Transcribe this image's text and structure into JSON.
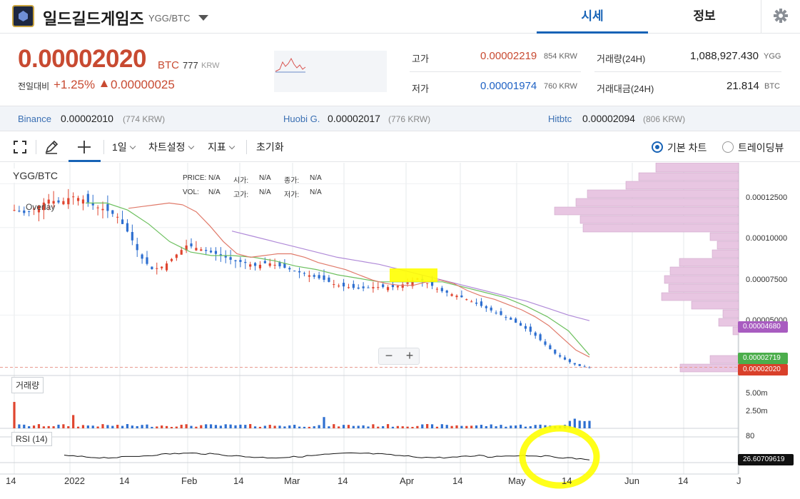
{
  "header": {
    "coin_name": "일드길드게임즈",
    "pair": "YGG/BTC",
    "tab_active": "시세",
    "tab_info": "정보"
  },
  "price": {
    "current": "0.00002020",
    "unit": "BTC",
    "krw": "777",
    "krw_unit": "KRW",
    "change_label": "전일대비",
    "change_pct": "+1.25%",
    "change_val": "0.00000025"
  },
  "stats": {
    "high_label": "고가",
    "high": "0.00002219",
    "high_krw": "854 KRW",
    "low_label": "저가",
    "low": "0.00001974",
    "low_krw": "760 KRW",
    "vol_label": "거래량(24H)",
    "vol": "1,088,927.430",
    "vol_unit": "YGG",
    "amt_label": "거래대금(24H)",
    "amt": "21.814",
    "amt_unit": "BTC"
  },
  "exchanges": [
    {
      "name": "Binance",
      "price": "0.00002010",
      "krw": "(774 KRW)"
    },
    {
      "name": "Huobi G.",
      "price": "0.00002017",
      "krw": "(776 KRW)"
    },
    {
      "name": "Hitbtc",
      "price": "0.00002094",
      "krw": "(806 KRW)"
    }
  ],
  "toolbar": {
    "fullscreen_icon": "fullscreen-icon",
    "draw_icon": "pencil-icon",
    "crosshair_icon": "plus-icon",
    "interval": "1일",
    "chart_settings": "차트설정",
    "indicators": "지표",
    "reset": "초기화",
    "basic_chart": "기본 차트",
    "trading_view": "트레이딩뷰"
  },
  "chart_data": {
    "type": "candlestick",
    "symbol": "YGG/BTC",
    "overlay_label": "Overlay",
    "info": {
      "price_label": "PRICE:",
      "price": "N/A",
      "open_label": "시가:",
      "open": "N/A",
      "close_label": "종가:",
      "close": "N/A",
      "vol_label": "VOL:",
      "vol": "N/A",
      "high_label": "고가:",
      "high": "N/A",
      "low_label": "저가:",
      "low": "N/A"
    },
    "x_ticks": [
      "14",
      "2022",
      "14",
      "Feb",
      "14",
      "Mar",
      "14",
      "Apr",
      "14",
      "May",
      "14",
      "Jun",
      "14",
      "J"
    ],
    "y_ticks": [
      "0.00012500",
      "0.00010000",
      "0.00007500",
      "0.00005000"
    ],
    "ylim": [
      1.55e-05,
      0.000137
    ],
    "close_approx": [
      0.00011,
      0.000108,
      0.000112,
      0.000116,
      0.000114,
      0.000118,
      0.000116,
      0.000112,
      0.00011,
      0.000106,
      9.6e-05,
      8.3e-05,
      7.6e-05,
      7.8e-05,
      8.4e-05,
      9e-05,
      8.8e-05,
      8.6e-05,
      8.4e-05,
      8.1e-05,
      8e-05,
      7.8e-05,
      8e-05,
      7.8e-05,
      7.6e-05,
      7.4e-05,
      7.2e-05,
      7e-05,
      6.7e-05,
      6.6e-05,
      6.5e-05,
      6.6e-05,
      6.6e-05,
      6.6e-05,
      6.8e-05,
      7.1e-05,
      6.8e-05,
      6.4e-05,
      6.2e-05,
      6e-05,
      5.7e-05,
      5.4e-05,
      5.1e-05,
      4.8e-05,
      4.4e-05,
      4e-05,
      3.4e-05,
      2.8e-05,
      2.4e-05,
      2.1e-05,
      2.02e-05
    ],
    "ma_short": [
      0.000111,
      0.000112,
      0.000113,
      0.000114,
      0.000113,
      0.000109,
      0.000101,
      9.2e-05,
      8.5e-05,
      8.3e-05,
      8.4e-05,
      8.5e-05,
      8.5e-05,
      8.3e-05,
      8e-05,
      7.8e-05,
      7.6e-05,
      7.3e-05,
      7e-05,
      6.8e-05,
      6.7e-05,
      6.7e-05,
      6.9e-05,
      7e-05,
      6.8e-05,
      6.4e-05,
      6.1e-05,
      5.9e-05,
      5.6e-05,
      5.3e-05,
      4.9e-05,
      4.4e-05,
      3.7e-05,
      3e-05,
      2.6e-05
    ],
    "ma_mid": [
      0.000114,
      0.000114,
      0.00011,
      0.000102,
      9.2e-05,
      8.6e-05,
      8.4e-05,
      8.4e-05,
      8.3e-05,
      8.1e-05,
      7.8e-05,
      7.6e-05,
      7.3e-05,
      7.1e-05,
      6.9e-05,
      6.9e-05,
      6.9e-05,
      6.9e-05,
      6.6e-05,
      6.3e-05,
      6e-05,
      5.5e-05,
      4.9e-05,
      4.1e-05,
      2.72e-05
    ],
    "ma_long": [
      9.8e-05,
      9.5e-05,
      9.2e-05,
      8.9e-05,
      8.6e-05,
      8.3e-05,
      8.1e-05,
      7.9e-05,
      7.6e-05,
      7.3e-05,
      7e-05,
      6.7e-05,
      6.4e-05,
      6.1e-05,
      5.8e-05,
      5.4e-05,
      5e-05,
      4.68e-05
    ],
    "price_tags": [
      "0.00004680",
      "0.00002719",
      "0.00002020"
    ],
    "volume_label": "거래량",
    "volume_ticks": [
      "5.00m",
      "2.50m"
    ],
    "rsi_label": "RSI (14)",
    "rsi_ticks": [
      "80"
    ],
    "rsi_value": "26.60709619",
    "colors": {
      "up": "#e0452f",
      "down": "#2e6fd0",
      "ma_short": "#e07a6a",
      "ma_mid": "#6dc05f",
      "ma_long": "#b08ad8",
      "profile": "#e8c6e2",
      "highlight": "#ffff00"
    }
  }
}
